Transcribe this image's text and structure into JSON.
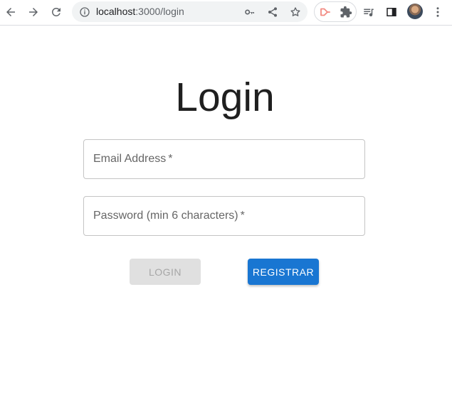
{
  "browser": {
    "url_host": "localhost",
    "url_path": ":3000/login",
    "icons": {
      "back": "arrow-left-icon",
      "forward": "arrow-right-icon",
      "reload": "reload-icon",
      "info": "info-icon",
      "key": "key-icon",
      "share": "share-icon",
      "bookmark": "star-icon",
      "extension1": "play-outline-icon",
      "extension2": "puzzle-icon",
      "media": "media-queue-icon",
      "side_panel": "side-panel-icon",
      "menu": "kebab-menu-icon"
    }
  },
  "login": {
    "title": "Login",
    "email_label": "Email Address",
    "password_label": "Password (min 6 characters)",
    "required_mark": "*",
    "login_button": "LOGIN",
    "register_button": "REGISTRAR"
  },
  "colors": {
    "primary": "#1976d2",
    "disabled_bg": "#e0e0e0",
    "disabled_text": "#a6a6a6"
  }
}
